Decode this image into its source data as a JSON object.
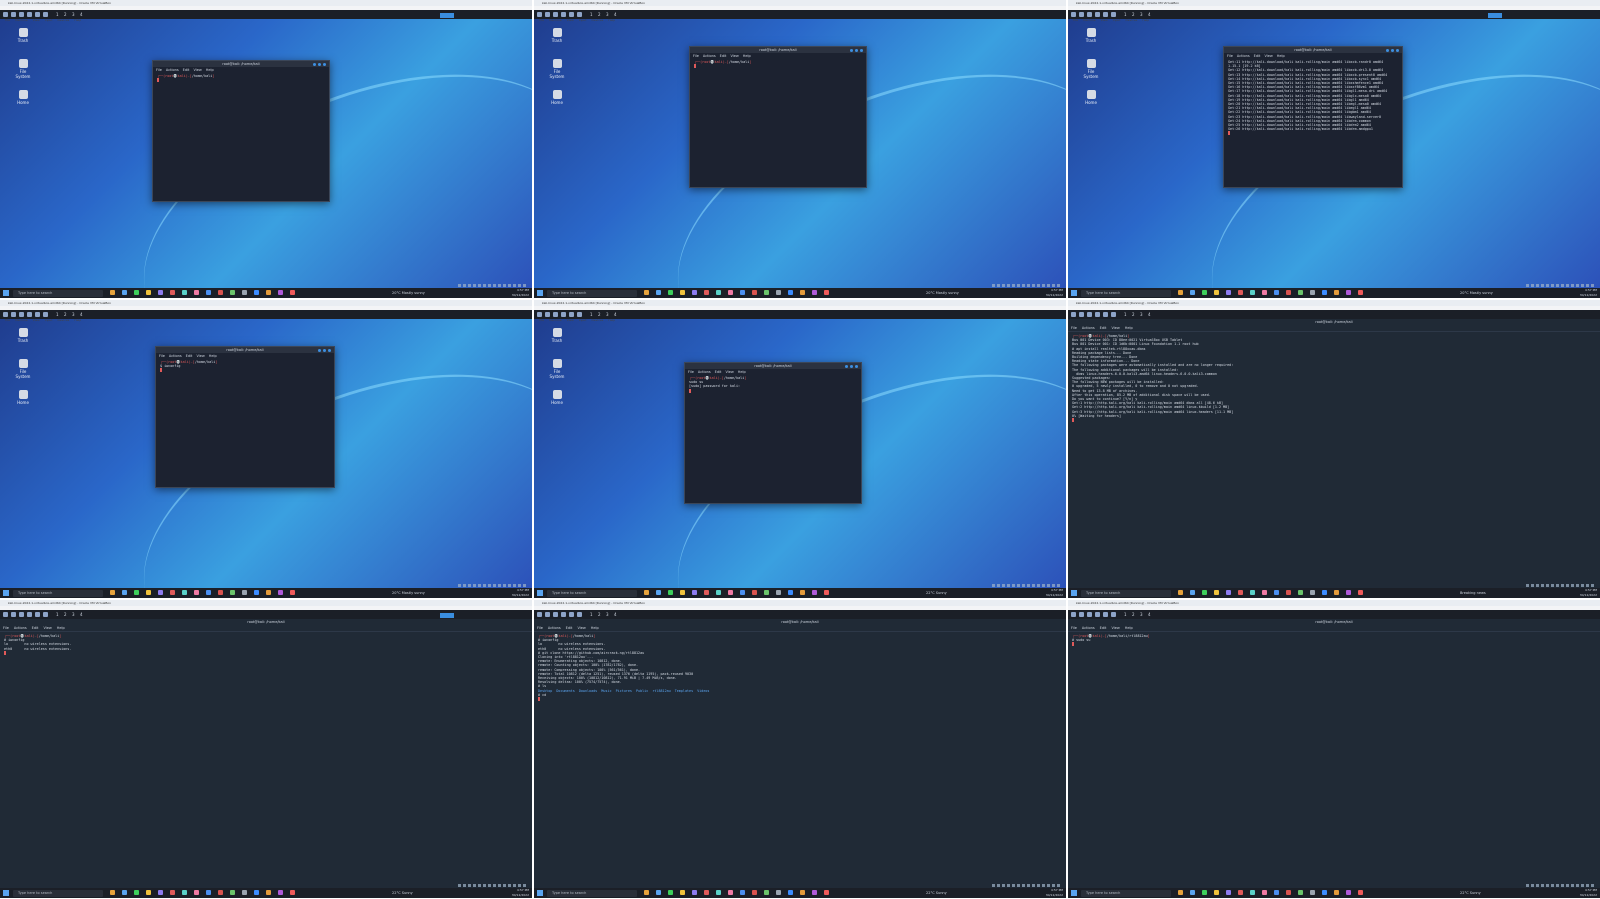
{
  "vm_title": "kali-linux-2022.1-virtualbox-amd64 [Running] - Oracle VM VirtualBox",
  "vm_menu": [
    "File",
    "Machine",
    "View",
    "Input",
    "Devices",
    "Help"
  ],
  "desktop_icons": [
    "Trash",
    "File System",
    "Home"
  ],
  "terminal": {
    "title": "root@kali: /home/kali",
    "menu": [
      "File",
      "Actions",
      "Edit",
      "View",
      "Help"
    ]
  },
  "taskbar": {
    "search_placeholder": "Type here to search",
    "weather": [
      "20°C Mostly sunny",
      "20°C Mostly sunny",
      "20°C Mostly sunny",
      "20°C Mostly sunny",
      "22°C Sunny",
      "Breaking news",
      "22°C Sunny",
      "22°C Sunny",
      "22°C Sunny"
    ],
    "time": "4:57 PM",
    "date": "30/12/2022"
  },
  "cells": [
    {
      "prompt": "/home/kali",
      "lines": [],
      "typed": ""
    },
    {
      "prompt": "/home/kali",
      "lines": [],
      "typed": ""
    },
    {
      "prompt": "",
      "lines": [
        "Get:11 http://kali.download/kali kali-rolling/main amd64 libxcb-randr0 amd64",
        "1.15-1 [19.2 kB]",
        "Get:12 http://kali.download/kali kali-rolling/main amd64 libxcb-dri3-0 amd64",
        "Get:13 http://kali.download/kali kali-rolling/main amd64 libxcb-present0 amd64",
        "Get:14 http://kali.download/kali kali-rolling/main amd64 libxcb-sync1 amd64",
        "Get:15 http://kali.download/kali kali-rolling/main amd64 libxshmfence1 amd64",
        "Get:16 http://kali.download/kali kali-rolling/main amd64 libxxf86vm1 amd64",
        "Get:17 http://kali.download/kali kali-rolling/main amd64 libgl1-mesa-dri amd64",
        "Get:18 http://kali.download/kali kali-rolling/main amd64 libglx-mesa0 amd64",
        "Get:19 http://kali.download/kali kali-rolling/main amd64 libgl1 amd64",
        "Get:20 http://kali.download/kali kali-rolling/main amd64 libegl-mesa0 amd64",
        "Get:21 http://kali.download/kali kali-rolling/main amd64 libegl1 amd64",
        "Get:22 http://kali.download/kali kali-rolling/main amd64 libgbm1 amd64",
        "Get:23 http://kali.download/kali kali-rolling/main amd64 libwayland-server0",
        "Get:24 http://kali.download/kali kali-rolling/main amd64 libdrm-common",
        "Get:25 http://kali.download/kali kali-rolling/main amd64 libdrm2 amd64",
        "Get:26 http://kali.download/kali kali-rolling/main amd64 libdrm-amdgpu1"
      ],
      "typed": ""
    },
    {
      "prompt": "/home/kali",
      "lines": [
        "$ iwconfig"
      ],
      "typed": ""
    },
    {
      "prompt": "/home/kali",
      "lines": [
        "[sudo] password for kali:"
      ],
      "typed": "sudo su"
    },
    {
      "prompt": "/home/kali",
      "lines": [
        "Bus 001 Device 003: ID 80ee:0021 VirtualBox USB Tablet",
        "Bus 001 Device 001: ID 1d6b:0001 Linux Foundation 1.1 root hub",
        "# apt install realtek-rtl88xxau-dkms",
        "Reading package lists... Done",
        "Building dependency tree... Done",
        "Reading state information... Done",
        "The following packages were automatically installed and are no longer required:",
        "The following additional packages will be installed:",
        "  dkms linux-headers-6.0.0-kali3-amd64 linux-headers-6.0.0-kali3-common",
        "Suggested packages:",
        "The following NEW packages will be installed:",
        "0 upgraded, 5 newly installed, 0 to remove and 0 not upgraded.",
        "Need to get 13.8 MB of archives.",
        "After this operation, 85.2 MB of additional disk space will be used.",
        "Do you want to continue? [Y/n] y",
        "Get:1 http://http.kali.org/kali kali-rolling/main amd64 dkms all [48.6 kB]",
        "Get:2 http://http.kali.org/kali kali-rolling/main amd64 linux-kbuild [1.2 MB]",
        "Get:3 http://http.kali.org/kali kali-rolling/main amd64 linux-headers [11.1 MB]",
        "0% [Waiting for headers]"
      ],
      "typed": ""
    },
    {
      "prompt": "/home/kali",
      "lines": [
        "# iwconfig",
        "lo        no wireless extensions.",
        "",
        "eth0      no wireless extensions.",
        ""
      ],
      "typed": ""
    },
    {
      "prompt": "/home/kali",
      "lines": [
        "# iwconfig",
        "lo        no wireless extensions.",
        "",
        "eth0      no wireless extensions.",
        "",
        "# git clone https://github.com/aircrack-ng/rtl8812au",
        "Cloning into 'rtl8812au'...",
        "remote: Enumerating objects: 10812, done.",
        "remote: Counting objects: 100% (1782/1782), done.",
        "remote: Compressing objects: 100% (561/561), done.",
        "remote: Total 10812 (delta 1251), reused 1376 (delta 1195), pack-reused 9030",
        "Receiving objects: 100% (10812/10812), 71.91 MiB | 7.49 MiB/s, done.",
        "Resolving deltas: 100% (7574/7574), done.",
        "",
        "# ls",
        "Desktop  Documents  Downloads  Music  Pictures  Public  rtl8812au  Templates  Videos",
        "",
        "# cd"
      ],
      "typed": ""
    },
    {
      "prompt": "/home/kali/rtl8812au",
      "lines": [
        "# sudo su"
      ],
      "typed": ""
    }
  ]
}
